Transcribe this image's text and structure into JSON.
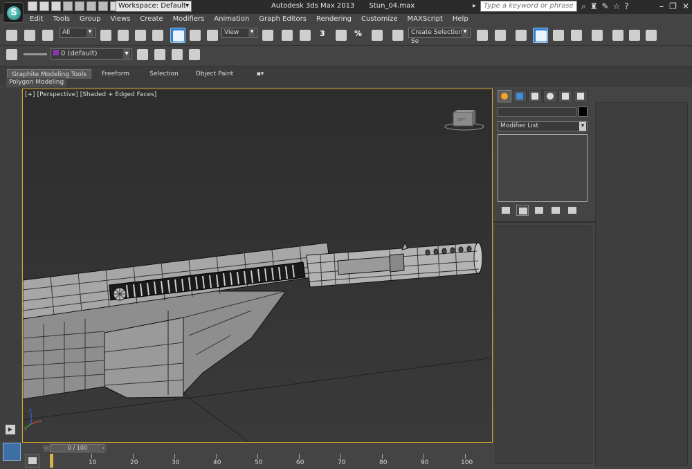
{
  "title_bar": {
    "app_name": "Autodesk 3ds Max  2013",
    "file_name": "Stun_04.max",
    "workspace": "Workspace: Default",
    "search_placeholder": "Type a keyword or phrase",
    "logo_glyph": "S"
  },
  "menu": [
    "Edit",
    "Tools",
    "Group",
    "Views",
    "Create",
    "Modifiers",
    "Animation",
    "Graph Editors",
    "Rendering",
    "Customize",
    "MAXScript",
    "Help"
  ],
  "main_toolbar": {
    "selection_filter": "All",
    "reference_coord": "View",
    "named_selection_placeholder": "Create Selection Se",
    "snap_label": "3",
    "percent_label": "%"
  },
  "layer_toolbar": {
    "current_layer": "0 (default)"
  },
  "ribbon": {
    "tabs": [
      "Graphite Modeling Tools",
      "Freeform",
      "Selection",
      "Object Paint"
    ],
    "active_tab": "Graphite Modeling Tools",
    "subpanel": "Polygon Modeling"
  },
  "viewport": {
    "label_plus": "[+]",
    "label_view": "[Perspective]",
    "label_shading": "[Shaded + Edged Faces]",
    "viewcube_face": "LEFT"
  },
  "command_panel": {
    "modifier_list": "Modifier List",
    "object_color": "#000000"
  },
  "timeline": {
    "frame_display": "0 / 100",
    "ticks": [
      "10",
      "20",
      "30",
      "40",
      "50",
      "60",
      "70",
      "80",
      "90",
      "100"
    ]
  },
  "colors": {
    "viewport_border": "#d7a92a",
    "active_button": "#2f7ed1",
    "background": "#444444"
  }
}
